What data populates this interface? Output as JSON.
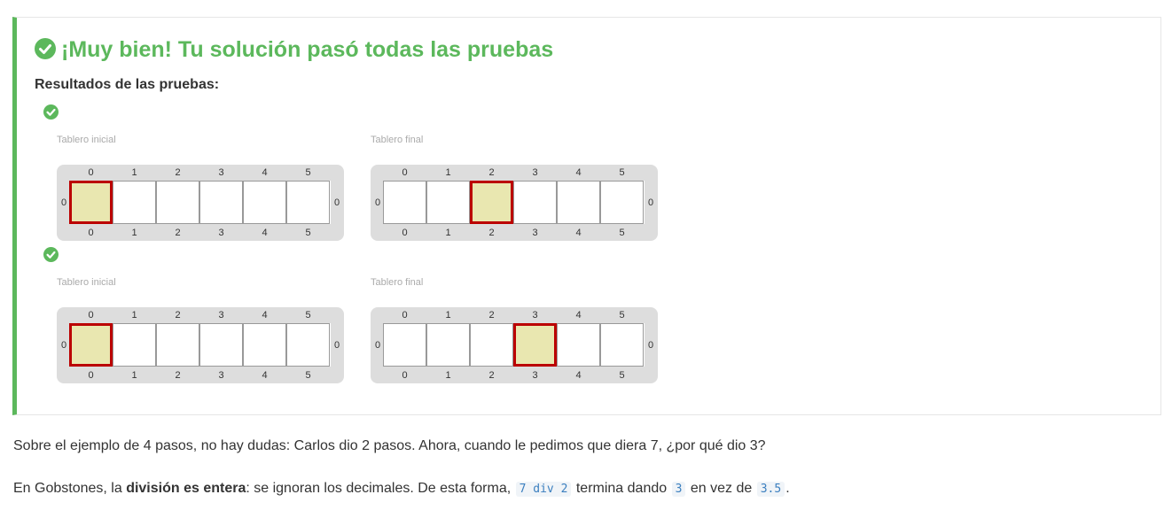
{
  "result": {
    "title": "¡Muy bien! Tu solución pasó todas las pruebas",
    "status_icon": "check-circle-icon",
    "accent_color": "#5cb85c",
    "results_label": "Resultados de las pruebas:"
  },
  "tests": [
    {
      "status": "passed",
      "initial_board": {
        "caption": "Tablero inicial",
        "columns": [
          "0",
          "1",
          "2",
          "3",
          "4",
          "5"
        ],
        "rows": [
          "0"
        ],
        "head_column": 0
      },
      "final_board": {
        "caption": "Tablero final",
        "columns": [
          "0",
          "1",
          "2",
          "3",
          "4",
          "5"
        ],
        "rows": [
          "0"
        ],
        "head_column": 2
      }
    },
    {
      "status": "passed",
      "initial_board": {
        "caption": "Tablero inicial",
        "columns": [
          "0",
          "1",
          "2",
          "3",
          "4",
          "5"
        ],
        "rows": [
          "0"
        ],
        "head_column": 0
      },
      "final_board": {
        "caption": "Tablero final",
        "columns": [
          "0",
          "1",
          "2",
          "3",
          "4",
          "5"
        ],
        "rows": [
          "0"
        ],
        "head_column": 3
      }
    }
  ],
  "explanation": {
    "p1": "Sobre el ejemplo de 4 pasos, no hay dudas: Carlos dio 2 pasos. Ahora, cuando le pedimos que diera 7, ¿por qué dio 3?",
    "p2_part1": "En Gobstones, la ",
    "p2_bold": "división es entera",
    "p2_part2": ": se ignoran los decimales. De esta forma, ",
    "p2_code1": "7 div 2",
    "p2_part3": " termina dando ",
    "p2_code2": "3",
    "p2_part4": " en vez de ",
    "p2_code3": "3.5",
    "p2_part5": "."
  },
  "colors": {
    "success": "#5cb85c",
    "board_background": "#dddddd",
    "head_fill": "#e9e7b0",
    "head_border": "#bb0000",
    "code_text": "#3b7fbf"
  }
}
